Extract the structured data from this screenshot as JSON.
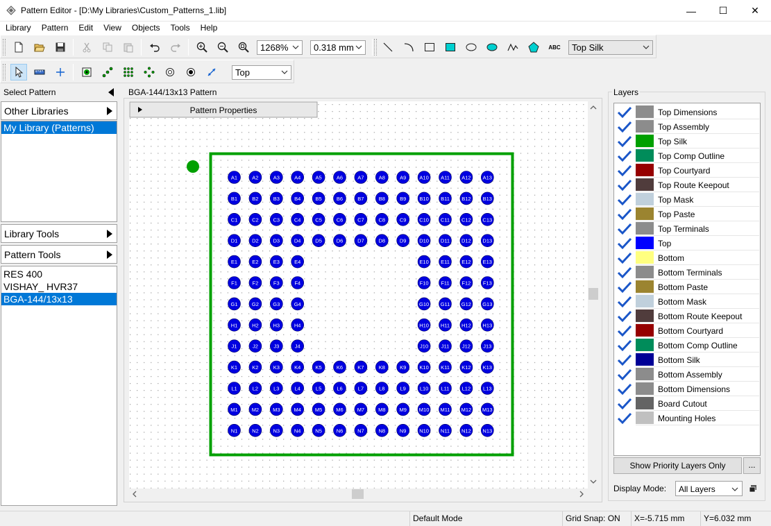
{
  "window": {
    "title": "Pattern Editor - [D:\\My Libraries\\Custom_Patterns_1.lib]",
    "minimize_glyph": "—",
    "maximize_glyph": "☐",
    "close_glyph": "✕"
  },
  "menu": [
    "Library",
    "Pattern",
    "Edit",
    "View",
    "Objects",
    "Tools",
    "Help"
  ],
  "toolbar": {
    "zoom": "1268%",
    "grid": "0.318 mm",
    "text_tool_label": "ABC",
    "layer": "Top Silk",
    "side": "Top"
  },
  "left_panel": {
    "header": "Select Pattern",
    "other_libraries": "Other Libraries",
    "libraries": [
      "My Library (Patterns)"
    ],
    "library_tools": "Library Tools",
    "pattern_tools": "Pattern Tools",
    "patterns": [
      "RES 400",
      "VISHAY_ HVR37",
      "BGA-144/13x13"
    ],
    "selected_pattern_index": 2
  },
  "canvas": {
    "title": "BGA-144/13x13 Pattern",
    "properties_tab": "Pattern Properties",
    "rows": [
      "A",
      "B",
      "C",
      "D",
      "E",
      "F",
      "G",
      "H",
      "J",
      "K",
      "L",
      "M",
      "N"
    ],
    "pad_color": "#0000e0",
    "silk_color": "#00a000"
  },
  "layers": {
    "title": "Layers",
    "items": [
      {
        "name": "Top Dimensions",
        "color": "#8c8c8c"
      },
      {
        "name": "Top Assembly",
        "color": "#8c8c8c"
      },
      {
        "name": "Top Silk",
        "color": "#00a000"
      },
      {
        "name": "Top Comp Outline",
        "color": "#008c5a"
      },
      {
        "name": "Top Courtyard",
        "color": "#960000"
      },
      {
        "name": "Top Route Keepout",
        "color": "#503c3c"
      },
      {
        "name": "Top Mask",
        "color": "#c0d0dc"
      },
      {
        "name": "Top Paste",
        "color": "#9b8430"
      },
      {
        "name": "Top Terminals",
        "color": "#8c8c8c"
      },
      {
        "name": "Top",
        "color": "#0000ff"
      },
      {
        "name": "Bottom",
        "color": "#ffff80"
      },
      {
        "name": "Bottom Terminals",
        "color": "#8c8c8c"
      },
      {
        "name": "Bottom Paste",
        "color": "#9b8430"
      },
      {
        "name": "Bottom Mask",
        "color": "#c0d0dc"
      },
      {
        "name": "Bottom Route Keepout",
        "color": "#503c3c"
      },
      {
        "name": "Bottom Courtyard",
        "color": "#960000"
      },
      {
        "name": "Bottom Comp Outline",
        "color": "#008c5a"
      },
      {
        "name": "Bottom Silk",
        "color": "#000096"
      },
      {
        "name": "Bottom Assembly",
        "color": "#8c8c8c"
      },
      {
        "name": "Bottom Dimensions",
        "color": "#8c8c8c"
      },
      {
        "name": "Board Cutout",
        "color": "#646464"
      },
      {
        "name": "Mounting Holes",
        "color": "#c0c0c0"
      }
    ],
    "show_priority": "Show Priority Layers Only",
    "more": "...",
    "display_mode_label": "Display Mode:",
    "display_mode": "All Layers"
  },
  "status": {
    "mode": "Default Mode",
    "grid_snap": "Grid Snap: ON",
    "x": "X=-5.715 mm",
    "y": "Y=6.032 mm"
  }
}
